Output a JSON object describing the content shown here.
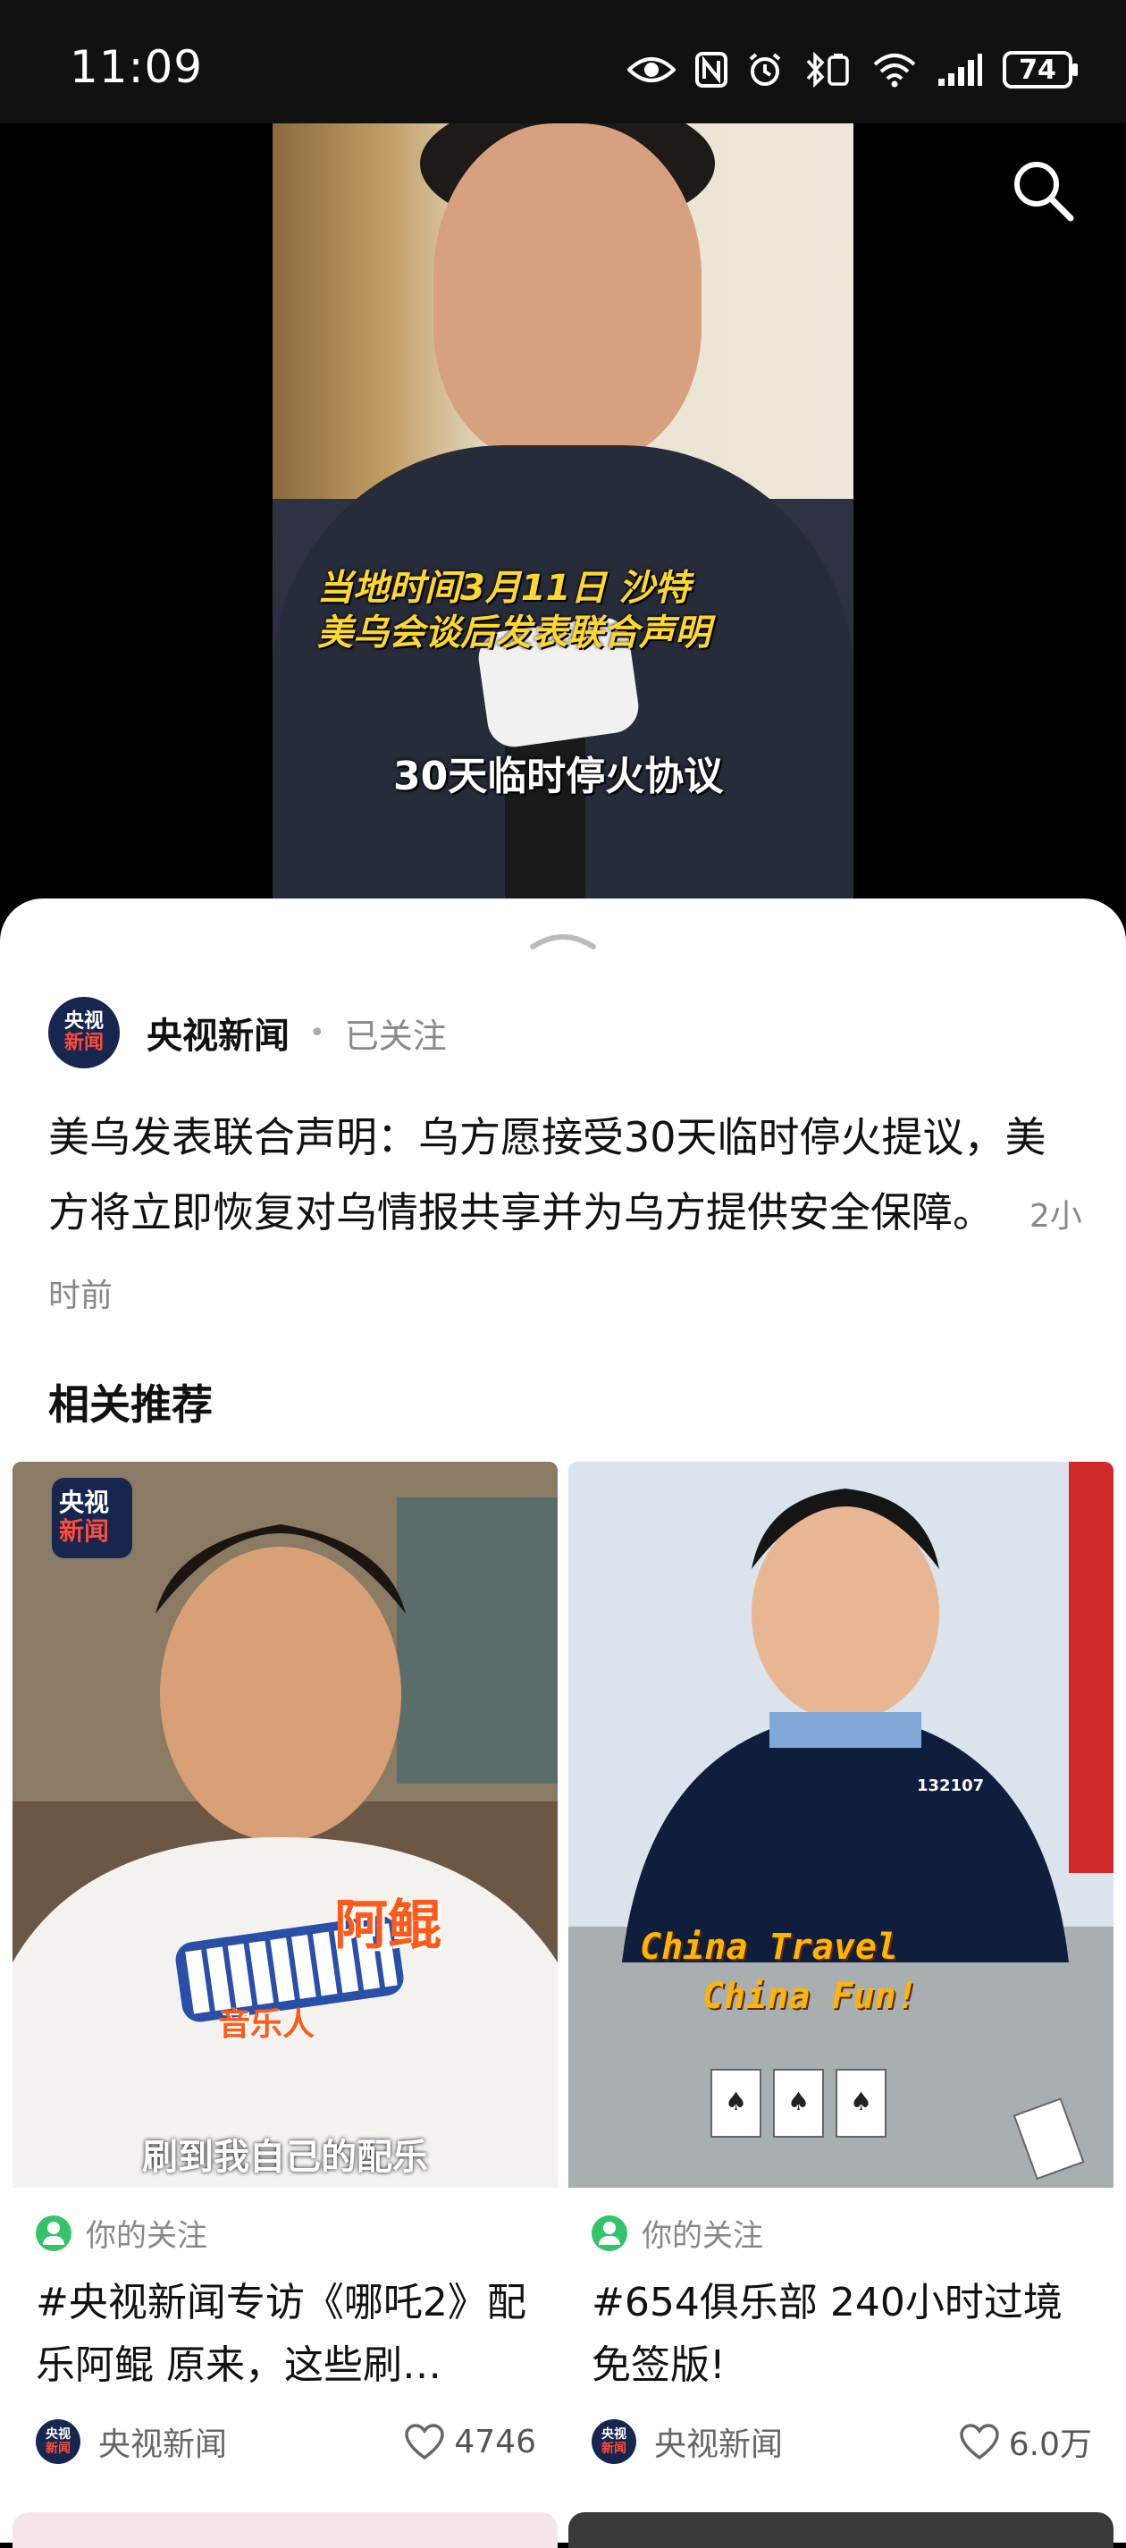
{
  "status_bar": {
    "time": "11:09",
    "battery": "74"
  },
  "video": {
    "caption_line1": "当地时间3月11日 沙特",
    "caption_line2": "美乌会谈后发表联合声明",
    "caption_bottom": "30天临时停火协议"
  },
  "post": {
    "author_name": "央视新闻",
    "logo_top": "央视",
    "logo_bottom": "新闻",
    "follow_status": "已关注",
    "description": "美乌发表联合声明：乌方愿接受30天临时停火提议，美方将立即恢复对乌情报共享并为乌方提供安全保障。",
    "time_ago": "2小时前"
  },
  "related": {
    "section_title": "相关推荐",
    "cards": [
      {
        "tag": "你的关注",
        "title": "#央视新闻专访《哪吒2》配乐阿鲲 原来，这些刷…",
        "author": "央视新闻",
        "likes": "4746",
        "thumb_text_big": "阿鲲",
        "thumb_text_small": "音乐人",
        "thumb_subtitle": "刷到我自己的配乐",
        "badge_top": "央视",
        "badge_bottom": "新闻"
      },
      {
        "tag": "你的关注",
        "title": "#654俱乐部 240小时过境免签版!",
        "author": "央视新闻",
        "likes": "6.0万",
        "thumb_line1": "China Travel",
        "thumb_line2": "China Fun!",
        "badge_number": "132107"
      }
    ]
  }
}
